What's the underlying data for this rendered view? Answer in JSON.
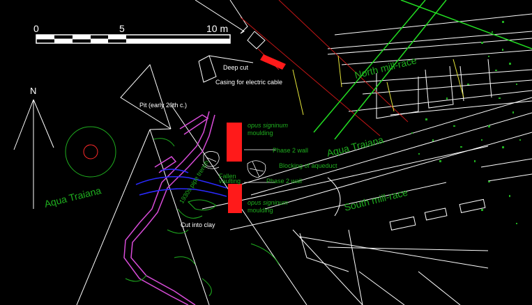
{
  "scale_bar": {
    "tick_0": "0",
    "tick_5": "5",
    "tick_10": "10 m"
  },
  "north_label": "N",
  "labels": {
    "deep_cut": "Deep cut",
    "casing": "Casing for electric cable",
    "pit": "Pit (early 20th c.)",
    "north_mill_race": "North mill-race",
    "south_mill_race": "South mill-race",
    "aqua_traiana_left": "Aqua Traiana",
    "aqua_traiana_right": "Aqua Traiana",
    "opus_top": "opus signinum",
    "moulding_top": "moulding",
    "phase2_top": "Phase 2 wall",
    "blocking": "Blocking of aqueduct",
    "fallen": "Fallen",
    "vaulting": "vaulting",
    "phase2_bottom": "Phase 2 wall",
    "opus_bottom": "opus signinum",
    "moulding_bottom": "moulding",
    "pipe_trench": "1930s pipe trench",
    "cut_into_clay": "Cut into clay"
  },
  "colors": {
    "background": "#000000",
    "line_white": "#ffffff",
    "line_green": "#1fae1f",
    "line_bright_green": "#22dd22",
    "line_red": "#ff1a1a",
    "line_magenta": "#d94cd9",
    "line_blue": "#2a2aff",
    "line_yellow": "#e6e63a"
  }
}
